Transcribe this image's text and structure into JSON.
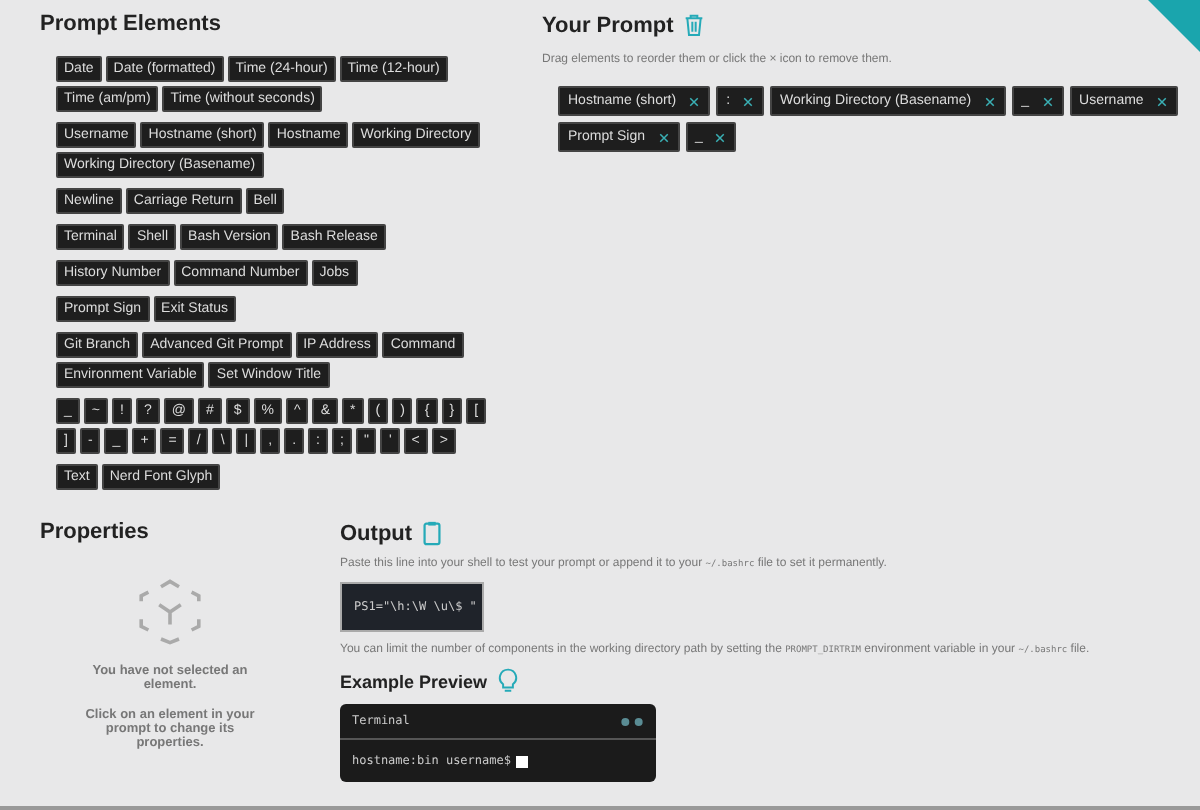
{
  "palette": {
    "title": "Prompt Elements",
    "groups": [
      [
        "Date",
        "Date (formatted)",
        "Time (24-hour)",
        "Time (12-hour)",
        "Time (am/pm)",
        "Time (without seconds)"
      ],
      [
        "Username",
        "Hostname (short)",
        "Hostname",
        "Working Directory",
        "Working Directory (Basename)"
      ],
      [
        "Newline",
        "Carriage Return",
        "Bell"
      ],
      [
        "Terminal",
        "Shell",
        "Bash Version",
        "Bash Release"
      ],
      [
        "History Number",
        "Command Number",
        "Jobs"
      ],
      [
        "Prompt Sign",
        "Exit Status"
      ],
      [
        "Git Branch",
        "Advanced Git Prompt",
        "IP Address",
        "Command",
        "Environment Variable",
        "Set Window Title"
      ],
      [
        "_",
        "~",
        "!",
        "?",
        "@",
        "#",
        "$",
        "%",
        "^",
        "&",
        "*",
        "(",
        ")",
        "{",
        "}",
        "[",
        "]",
        "-",
        "_",
        "+",
        "=",
        "/",
        "\\",
        "|",
        ",",
        ".",
        ":",
        ";",
        "\"",
        "'",
        "<",
        ">"
      ],
      [
        "Text",
        "Nerd Font Glyph"
      ]
    ]
  },
  "prompt": {
    "title": "Your Prompt",
    "hint": "Drag elements to reorder them or click the × icon to remove them.",
    "items": [
      "Hostname (short)",
      ":",
      "Working Directory (Basename)",
      "_",
      "Username",
      "Prompt Sign",
      "_"
    ]
  },
  "properties": {
    "title": "Properties",
    "empty_message": "You have not selected an element.",
    "help": "Click on an element in your prompt to change its properties."
  },
  "output": {
    "title": "Output",
    "intro": [
      {
        "kind": "text",
        "text": "Paste this line into your shell to test your prompt or append it to your "
      },
      {
        "kind": "code",
        "text": "~/.bashrc"
      },
      {
        "kind": "text",
        "text": " file to set it permanently."
      }
    ],
    "code": "PS1=\"\\h:\\W \\u\\$ \"",
    "note": [
      {
        "kind": "text",
        "text": "You can limit the number of components in the working directory path by setting the "
      },
      {
        "kind": "code",
        "text": "PROMPT_DIRTRIM"
      },
      {
        "kind": "text",
        "text": " environment variable in your "
      },
      {
        "kind": "code",
        "text": "~/.bashrc"
      },
      {
        "kind": "text",
        "text": " file."
      }
    ]
  },
  "preview": {
    "title": "Example Preview",
    "terminal_title": "Terminal",
    "line": "hostname:bin username$"
  }
}
